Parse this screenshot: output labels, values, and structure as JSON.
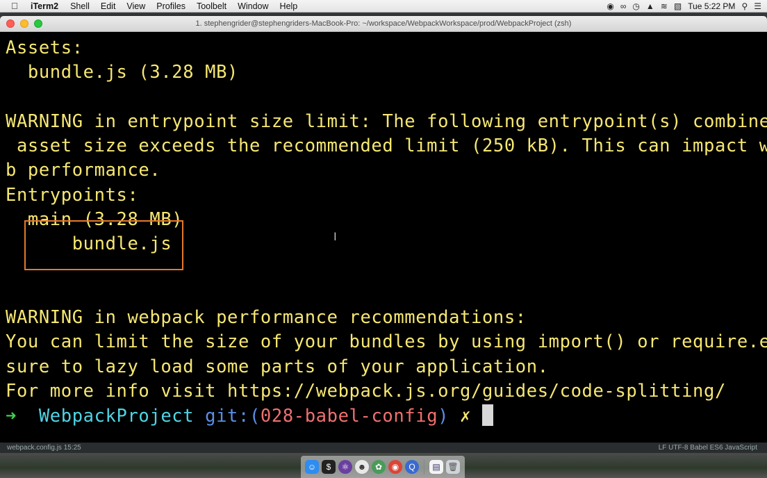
{
  "menubar": {
    "app": "iTerm2",
    "items": [
      "Shell",
      "Edit",
      "View",
      "Profiles",
      "Toolbelt",
      "Window",
      "Help"
    ],
    "clock": "Tue 5:22 PM"
  },
  "window": {
    "title": "1. stephengrider@stephengriders-MacBook-Pro: ~/workspace/WebpackWorkspace/prod/WebpackProject (zsh)"
  },
  "terminal": {
    "lines": [
      "Assets:",
      "  bundle.js (3.28 MB)",
      "",
      "WARNING in entrypoint size limit: The following entrypoint(s) combined",
      " asset size exceeds the recommended limit (250 kB). This can impact we",
      "b performance.",
      "Entrypoints:",
      "  main (3.28 MB)",
      "      bundle.js",
      "",
      "",
      "WARNING in webpack performance recommendations:",
      "You can limit the size of your bundles by using import() or require.en",
      "sure to lazy load some parts of your application.",
      "For more info visit https://webpack.js.org/guides/code-splitting/"
    ],
    "prompt": {
      "arrow": "➜",
      "directory": "WebpackProject",
      "git_label": "git:(",
      "branch": "028-babel-config",
      "git_close": ")",
      "dirty": "✗"
    }
  },
  "statusbar": {
    "left": "webpack.config.js  15:25",
    "right": "LF  UTF-8  Babel ES6 JavaScript"
  },
  "colors": {
    "terminal_text": "#f6e772",
    "highlight_border": "#e5792b",
    "prompt_arrow": "#3fd04f",
    "prompt_dir": "#4fd4e4",
    "branch": "#f07070"
  },
  "dock": {
    "apps": [
      "finder-icon",
      "terminal-icon",
      "atom-icon",
      "emoji-icon",
      "chrome-icon",
      "quicktime-icon",
      "document-icon",
      "trash-icon"
    ]
  }
}
